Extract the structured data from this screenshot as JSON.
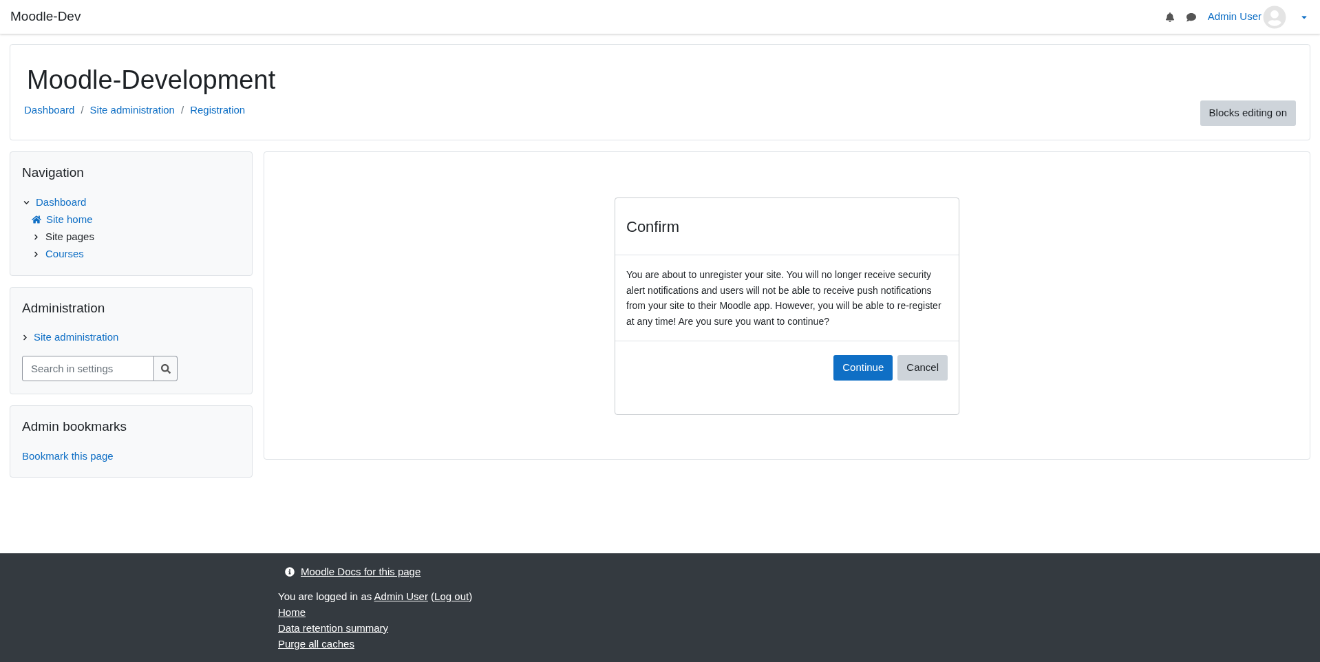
{
  "navbar": {
    "brand": "Moodle-Dev",
    "user_name": "Admin User"
  },
  "header": {
    "title": "Moodle-Development",
    "separator": "/",
    "breadcrumbs": [
      "Dashboard",
      "Site administration",
      "Registration"
    ],
    "edit_button": "Blocks editing on"
  },
  "navigation": {
    "title": "Navigation",
    "tree": [
      {
        "label": "Dashboard",
        "kind": "branch",
        "link": true,
        "expanded": true,
        "children": [
          {
            "label": "Site home",
            "kind": "home",
            "link": true
          },
          {
            "label": "Site pages",
            "kind": "branch",
            "link": false,
            "expanded": false
          },
          {
            "label": "Courses",
            "kind": "branch",
            "link": true,
            "expanded": false
          }
        ]
      }
    ]
  },
  "administration": {
    "title": "Administration",
    "items": [
      {
        "label": "Site administration",
        "expanded": false
      }
    ],
    "search": {
      "placeholder": "Search in settings"
    }
  },
  "admin_bookmarks": {
    "title": "Admin bookmarks",
    "link": "Bookmark this page"
  },
  "dialog": {
    "title": "Confirm",
    "message": "You are about to unregister your site. You will no longer receive security alert notifications and users will not be able to receive push notifications from your site to their Moodle app. However, you will be able to re-register at any time! Are you sure you want to continue?",
    "buttons": [
      {
        "label": "Continue",
        "kind": "primary"
      },
      {
        "label": "Cancel",
        "kind": "secondary"
      }
    ]
  },
  "footer": {
    "docs_link": "Moodle Docs for this page",
    "logged_in": {
      "prefix": "You are logged in as",
      "user_link": "Admin User",
      "open_paren": "(",
      "logout_link": "Log out",
      "close_paren": ")"
    },
    "links": [
      "Home",
      "Data retention summary",
      "Purge all caches"
    ]
  }
}
